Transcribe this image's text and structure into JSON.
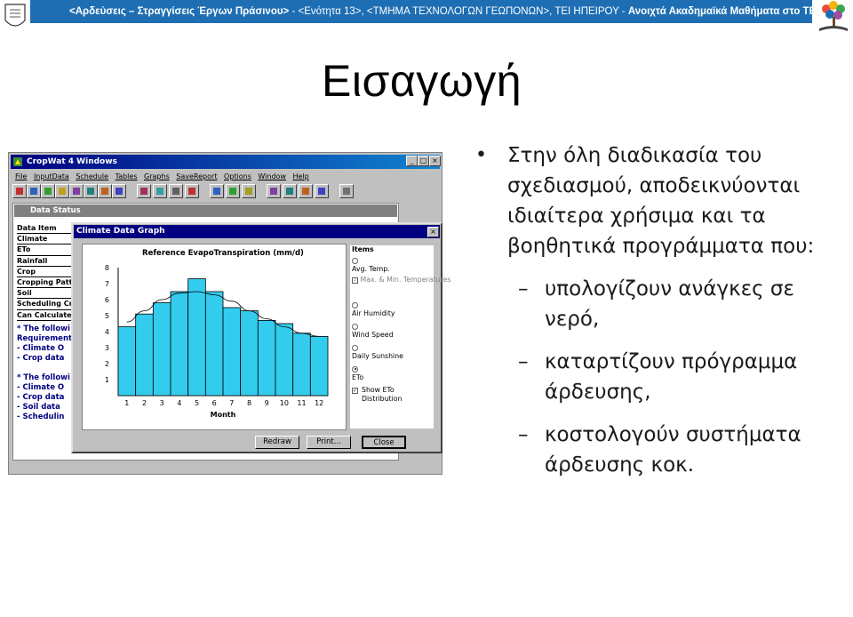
{
  "header": {
    "text_bold": "<Αρδεύσεις – Στραγγίσεις Έργων Πράσινου>",
    "text_rest": " - <Ενότητα 13>, <ΤΜΗΜΑ ΤΕΧΝΟΛΟΓΩΝ ΓΕΩΠΟΝΩΝ>, ΤΕΙ ΗΠΕΙΡΟΥ - ",
    "text_tail": "Ανοιχτά Ακαδημαϊκά Μαθήματα στο ΤΕΙ Ηπείρου",
    "color": "#1e6eb4"
  },
  "slide": {
    "title": "Εισαγωγή",
    "bullet": "Στην όλη διαδικασία του σχεδιασμού, αποδεικνύονται ιδιαίτερα χρήσιμα και τα βοηθητικά προγράμματα που:",
    "bullet_symbol": "•",
    "dash_symbol": "–",
    "sub_bullets": [
      "υπολογίζουν ανάγκες σε νερό,",
      "καταρτίζουν πρόγραμμα άρδευσης,",
      "κοστολογούν συστήματα άρδευσης κοκ."
    ]
  },
  "cropwat": {
    "window_title": "CropWat 4 Windows",
    "win_buttons": [
      "_",
      "□",
      "×"
    ],
    "menu": [
      "File",
      "InputData",
      "Schedule",
      "Tables",
      "Graphs",
      "SaveReport",
      "Options",
      "Window",
      "Help"
    ],
    "data_status": {
      "title": "Data Status",
      "items": [
        "Data Item",
        "Climate",
        "ETo",
        "Rainfall",
        "Crop",
        "Cropping Patter",
        "Soil",
        "Scheduling Crite",
        "Can Calculate"
      ],
      "notes": [
        "* The followi",
        "Requirement",
        "- Climate O",
        "- Crop data",
        "",
        "* The followi",
        "- Climate O",
        "- Crop data",
        "- Soil data",
        "- Schedulin"
      ]
    },
    "graph": {
      "title": "Climate Data Graph",
      "close_symbol": "×",
      "chart_title": "Reference EvapoTranspiration (mm/d)",
      "xlabel": "Month",
      "items_title": "Items",
      "options": [
        {
          "label": "Avg. Temp.",
          "kind": "radio",
          "on": false
        },
        {
          "label": "Max. & Min. Temperatures",
          "kind": "check",
          "on": true,
          "disabled": true
        },
        {
          "label": "Air Humidity",
          "kind": "radio",
          "on": false
        },
        {
          "label": "Wind Speed",
          "kind": "radio",
          "on": false
        },
        {
          "label": "Daily Sunshine",
          "kind": "radio",
          "on": false
        },
        {
          "label": "ETo",
          "kind": "radio",
          "on": true
        },
        {
          "label": "Show ETo Distribution",
          "kind": "check",
          "on": true
        }
      ],
      "buttons": [
        "Redraw",
        "Print...",
        "Close"
      ]
    }
  },
  "chart_data": {
    "type": "bar",
    "title": "Reference EvapoTranspiration (mm/d)",
    "xlabel": "Month",
    "ylabel": "",
    "categories": [
      "1",
      "2",
      "3",
      "4",
      "5",
      "6",
      "7",
      "8",
      "9",
      "10",
      "11",
      "12"
    ],
    "values": [
      4.3,
      5.1,
      5.8,
      6.5,
      7.3,
      6.5,
      5.5,
      5.3,
      4.7,
      4.5,
      3.9,
      3.7
    ],
    "smooth_curve": [
      4.6,
      5.3,
      6.0,
      6.4,
      6.5,
      6.3,
      5.9,
      5.3,
      4.8,
      4.3,
      3.9,
      3.7
    ],
    "ylim": [
      0,
      8
    ],
    "yticks": [
      "1",
      "2",
      "3",
      "4",
      "5",
      "6",
      "7",
      "8"
    ],
    "bar_color": "#33ccee",
    "grid": false
  }
}
